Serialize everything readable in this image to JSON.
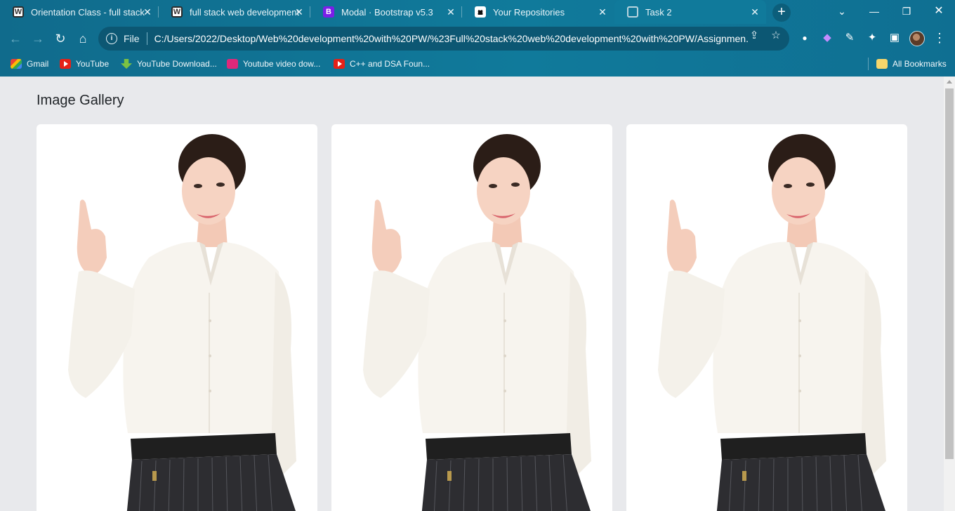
{
  "browser": {
    "tabs": [
      {
        "title": "Orientation Class - full stack",
        "favicon": "wordpress-icon",
        "active": false
      },
      {
        "title": "full stack web development",
        "favicon": "wordpress-icon",
        "active": false
      },
      {
        "title": "Modal · Bootstrap v5.3",
        "favicon": "bootstrap-icon",
        "active": false
      },
      {
        "title": "Your Repositories",
        "favicon": "github-icon",
        "active": false
      },
      {
        "title": "Task 2",
        "favicon": "globe-icon",
        "active": true
      }
    ],
    "address": {
      "scheme_label": "File",
      "url": "C:/Users/2022/Desktop/Web%20development%20with%20PW/%23Full%20stack%20web%20development%20with%20PW/Assignmen..."
    },
    "bookmarks": [
      {
        "label": "Gmail",
        "icon": "gmail-icon"
      },
      {
        "label": "YouTube",
        "icon": "youtube-icon"
      },
      {
        "label": "YouTube Download...",
        "icon": "download-icon"
      },
      {
        "label": "Youtube video dow...",
        "icon": "u-icon"
      },
      {
        "label": "C++ and DSA Foun...",
        "icon": "youtube-icon"
      }
    ],
    "all_bookmarks_label": "All Bookmarks",
    "accent_color": "#107a9b"
  },
  "page": {
    "title": "Image Gallery",
    "cards": [
      {
        "image": "woman-pointing-up-photo"
      },
      {
        "image": "woman-pointing-up-photo"
      },
      {
        "image": "woman-pointing-up-photo"
      }
    ],
    "background_color": "#e8e9ec"
  }
}
